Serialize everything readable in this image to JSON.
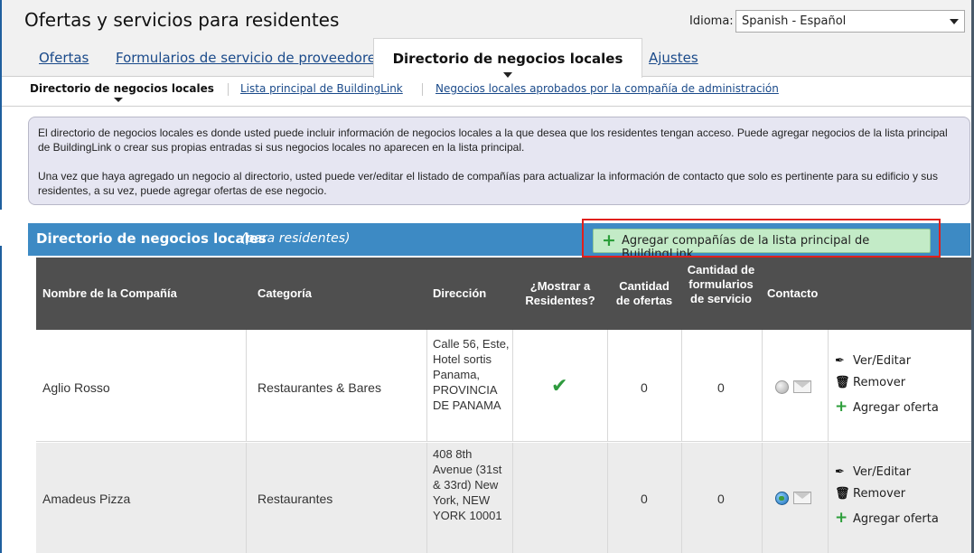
{
  "header": {
    "title": "Ofertas y servicios para residentes",
    "language_label": "Idioma:",
    "language_value": "Spanish - Español"
  },
  "main_tabs": [
    {
      "label": "Ofertas",
      "active": false
    },
    {
      "label": "Formularios de servicio de proveedores",
      "active": false
    },
    {
      "label": "Directorio de negocios locales",
      "active": true
    },
    {
      "label": "Ajustes",
      "active": false
    }
  ],
  "sub_tabs": [
    {
      "label": "Directorio de negocios locales",
      "active": true
    },
    {
      "label": "Lista principal de BuildingLink",
      "active": false
    },
    {
      "label": "Negocios locales aprobados por la compañía de administración",
      "active": false
    }
  ],
  "info": {
    "paragraph1": "El directorio de negocios locales es donde usted puede incluir información de negocios locales a la que desea que los residentes tengan acceso. Puede agregar negocios de la lista principal de BuildingLink o crear sus propias entradas si sus negocios locales no aparecen en la lista principal.",
    "paragraph2": "Una vez que haya agregado un negocio al directorio, usted puede ver/editar el listado de compañías para actualizar la información de contacto que solo es pertinente para su edificio y sus residentes, a su vez, puede agregar ofertas de ese negocio."
  },
  "section": {
    "title": "Directorio de negocios locales",
    "subtitle": "(para residentes)",
    "add_button_label": "Agregar compañías de la lista principal de BuildingLink"
  },
  "table": {
    "headers": {
      "company": "Nombre de la Compañía",
      "category": "Categoría",
      "address": "Dirección",
      "show_residents": "¿Mostrar a Residentes?",
      "offers_count": "Cantidad de ofertas",
      "forms_count": "Cantidad de formularios de servicio",
      "contact": "Contacto"
    },
    "rows": [
      {
        "company": "Aglio Rosso",
        "category": "Restaurantes & Bares",
        "address": "Calle 56, Este, Hotel sortis Panama, PROVINCIA DE PANAMA",
        "show_residents": true,
        "offers_count": "0",
        "forms_count": "0",
        "contact_icons": [
          "web-disabled-icon",
          "email-icon"
        ]
      },
      {
        "company": "Amadeus Pizza",
        "category": "Restaurantes",
        "address": "408 8th Avenue (31st & 33rd) New York, NEW YORK 10001",
        "show_residents": false,
        "offers_count": "0",
        "forms_count": "0",
        "contact_icons": [
          "globe-icon",
          "email-icon"
        ]
      }
    ],
    "actions": {
      "view_edit": "Ver/Editar",
      "remove": "Remover",
      "add_offer": "Agregar oferta"
    }
  },
  "colors": {
    "section_bar": "#3d8ac4",
    "table_header": "#4f4f4f",
    "add_button_bg": "#c3ebc7",
    "highlight_border": "#e0201c",
    "link": "#1a4a8a"
  }
}
